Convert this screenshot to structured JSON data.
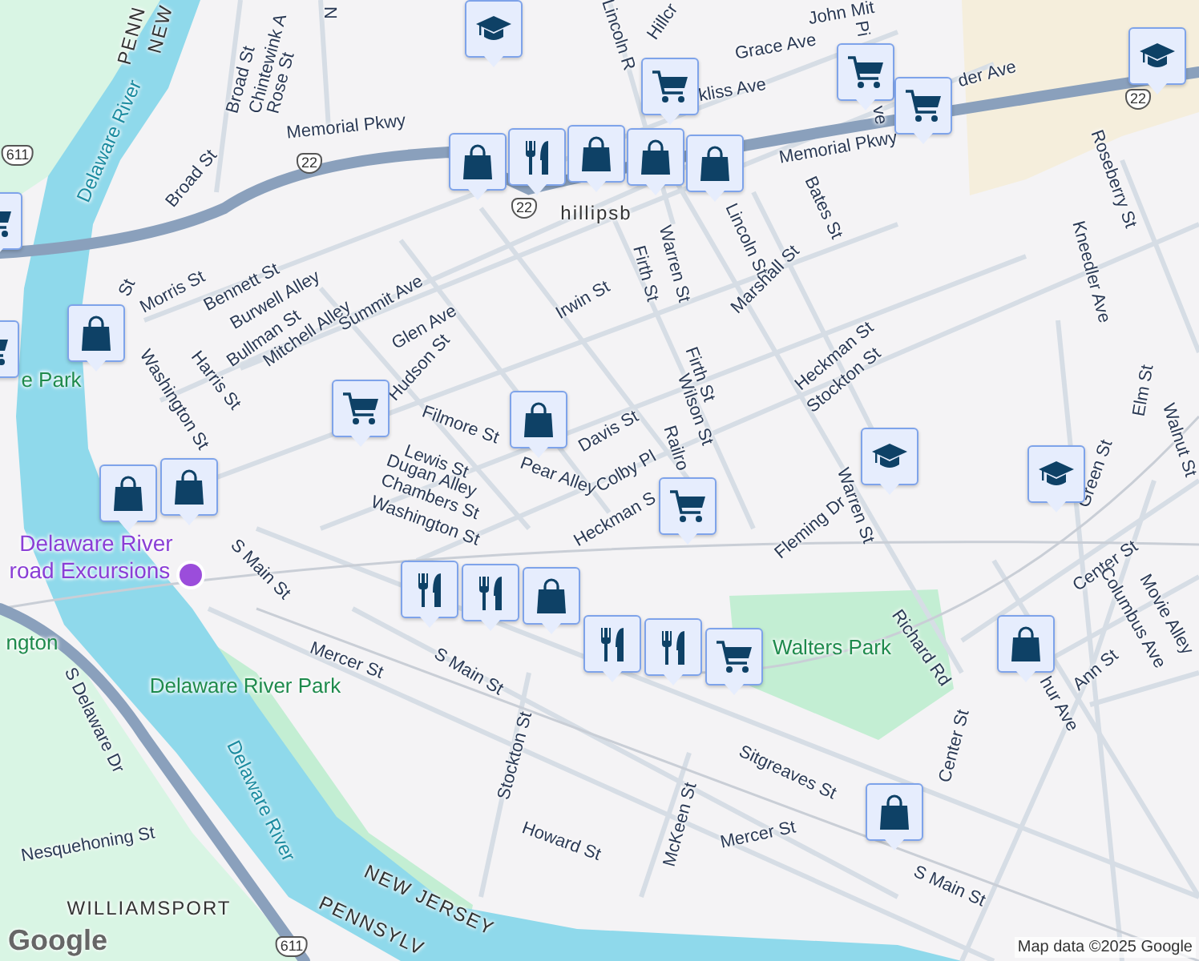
{
  "labels": [
    {
      "text": "PENN",
      "kind": "state"
    },
    {
      "text": "NEW",
      "kind": "state"
    },
    {
      "text": "Broad St",
      "kind": "street"
    },
    {
      "text": "Chintewink A",
      "kind": "street"
    },
    {
      "text": "Rose St",
      "kind": "street"
    },
    {
      "text": "N",
      "kind": "street"
    },
    {
      "text": "Memorial Pkwy",
      "kind": "street"
    },
    {
      "text": "Broad St",
      "kind": "street"
    },
    {
      "text": "St",
      "kind": "street"
    },
    {
      "text": "Morris St",
      "kind": "street"
    },
    {
      "text": "Bennett St",
      "kind": "street"
    },
    {
      "text": "Burwell Alley",
      "kind": "street"
    },
    {
      "text": "Bullman St",
      "kind": "street"
    },
    {
      "text": "Mitchell Alley",
      "kind": "street"
    },
    {
      "text": "Summit Ave",
      "kind": "street"
    },
    {
      "text": "Glen Ave",
      "kind": "street"
    },
    {
      "text": "Irwin St",
      "kind": "street"
    },
    {
      "text": "Hudson St",
      "kind": "street"
    },
    {
      "text": "Harris St",
      "kind": "street"
    },
    {
      "text": "Washington St",
      "kind": "street"
    },
    {
      "text": "Filmore St",
      "kind": "street"
    },
    {
      "text": "Pear Alley",
      "kind": "street"
    },
    {
      "text": "Lewis St",
      "kind": "street"
    },
    {
      "text": "Dugan Alley",
      "kind": "street"
    },
    {
      "text": "Chambers St",
      "kind": "street"
    },
    {
      "text": "Davis St",
      "kind": "street"
    },
    {
      "text": "Colby Pl",
      "kind": "street"
    },
    {
      "text": "Railro",
      "kind": "street"
    },
    {
      "text": "Heckman S",
      "kind": "street"
    },
    {
      "text": "Washington St",
      "kind": "street"
    },
    {
      "text": "S Main St",
      "kind": "street"
    },
    {
      "text": "Mercer St",
      "kind": "street"
    },
    {
      "text": "S Main St",
      "kind": "street"
    },
    {
      "text": "Stockton St",
      "kind": "street"
    },
    {
      "text": "Howard St",
      "kind": "street"
    },
    {
      "text": "McKeen St",
      "kind": "street"
    },
    {
      "text": "Mercer St",
      "kind": "street"
    },
    {
      "text": "Sitgreaves St",
      "kind": "street"
    },
    {
      "text": "S Main St",
      "kind": "street"
    },
    {
      "text": "Center St",
      "kind": "street"
    },
    {
      "text": "Richard Rd",
      "kind": "street"
    },
    {
      "text": "Walters Park",
      "kind": "park"
    },
    {
      "text": "Center St",
      "kind": "street"
    },
    {
      "text": "Fleming Dr",
      "kind": "street"
    },
    {
      "text": "Warren St",
      "kind": "street"
    },
    {
      "text": "Ann St",
      "kind": "street"
    },
    {
      "text": "Columbus Ave",
      "kind": "street"
    },
    {
      "text": "Movie Alley",
      "kind": "street"
    },
    {
      "text": "hur Ave",
      "kind": "street"
    },
    {
      "text": "Green St",
      "kind": "street"
    },
    {
      "text": "Walnut St",
      "kind": "street"
    },
    {
      "text": "Elm St",
      "kind": "street"
    },
    {
      "text": "Kneedler Ave",
      "kind": "street"
    },
    {
      "text": "Roseberry St",
      "kind": "street"
    },
    {
      "text": "der Ave",
      "kind": "street"
    },
    {
      "text": "Grace Ave",
      "kind": "street"
    },
    {
      "text": "kliss Ave",
      "kind": "street"
    },
    {
      "text": "John Mit",
      "kind": "street"
    },
    {
      "text": "Hillcr",
      "kind": "street"
    },
    {
      "text": "Lincoln R",
      "kind": "street"
    },
    {
      "text": "Pi",
      "kind": "street"
    },
    {
      "text": "ve",
      "kind": "street"
    },
    {
      "text": "Memorial Pkwy",
      "kind": "street"
    },
    {
      "text": "hillipsb",
      "kind": "town"
    },
    {
      "text": "Bates St",
      "kind": "street"
    },
    {
      "text": "Lincoln St",
      "kind": "street"
    },
    {
      "text": "Warren St",
      "kind": "street"
    },
    {
      "text": "Firth St",
      "kind": "street"
    },
    {
      "text": "Marshall St",
      "kind": "street"
    },
    {
      "text": "Firth St",
      "kind": "street"
    },
    {
      "text": "Wilson St",
      "kind": "street"
    },
    {
      "text": "Heckman St",
      "kind": "street"
    },
    {
      "text": "Stockton St",
      "kind": "street"
    },
    {
      "text": "Delaware River",
      "kind": "water"
    },
    {
      "text": "Delaware River",
      "kind": "water"
    },
    {
      "text": "S Delaware Dr",
      "kind": "street"
    },
    {
      "text": "Nesquehoning St",
      "kind": "street"
    },
    {
      "text": "WILLIAMSPORT",
      "kind": "town"
    },
    {
      "text": "NEW JERSEY",
      "kind": "state"
    },
    {
      "text": "PENNSYLV",
      "kind": "state"
    },
    {
      "text": "Delaware River Park",
      "kind": "park"
    },
    {
      "text": "Delaware River",
      "kind": "attraction"
    },
    {
      "text": "road Excursions",
      "kind": "attraction"
    },
    {
      "text": "e Park",
      "kind": "park"
    },
    {
      "text": "ngton",
      "kind": "park"
    },
    {
      "text": "22",
      "kind": "shield"
    },
    {
      "text": "22",
      "kind": "shield"
    },
    {
      "text": "22",
      "kind": "shield"
    },
    {
      "text": "611",
      "kind": "shield"
    },
    {
      "text": "611",
      "kind": "shield"
    }
  ],
  "pins": [
    {
      "kind": "school"
    },
    {
      "kind": "shop"
    },
    {
      "kind": "food"
    },
    {
      "kind": "shop"
    },
    {
      "kind": "cart"
    },
    {
      "kind": "shop"
    },
    {
      "kind": "shop"
    },
    {
      "kind": "cart"
    },
    {
      "kind": "cart"
    },
    {
      "kind": "school"
    },
    {
      "kind": "cart"
    },
    {
      "kind": "shop"
    },
    {
      "kind": "cart"
    },
    {
      "kind": "cart"
    },
    {
      "kind": "shop"
    },
    {
      "kind": "shop"
    },
    {
      "kind": "shop"
    },
    {
      "kind": "cart"
    },
    {
      "kind": "school"
    },
    {
      "kind": "school"
    },
    {
      "kind": "food"
    },
    {
      "kind": "food"
    },
    {
      "kind": "shop"
    },
    {
      "kind": "food"
    },
    {
      "kind": "food"
    },
    {
      "kind": "cart"
    },
    {
      "kind": "shop"
    },
    {
      "kind": "shop"
    }
  ],
  "attribution": "Map data ©2025 Google",
  "logo": "Google"
}
